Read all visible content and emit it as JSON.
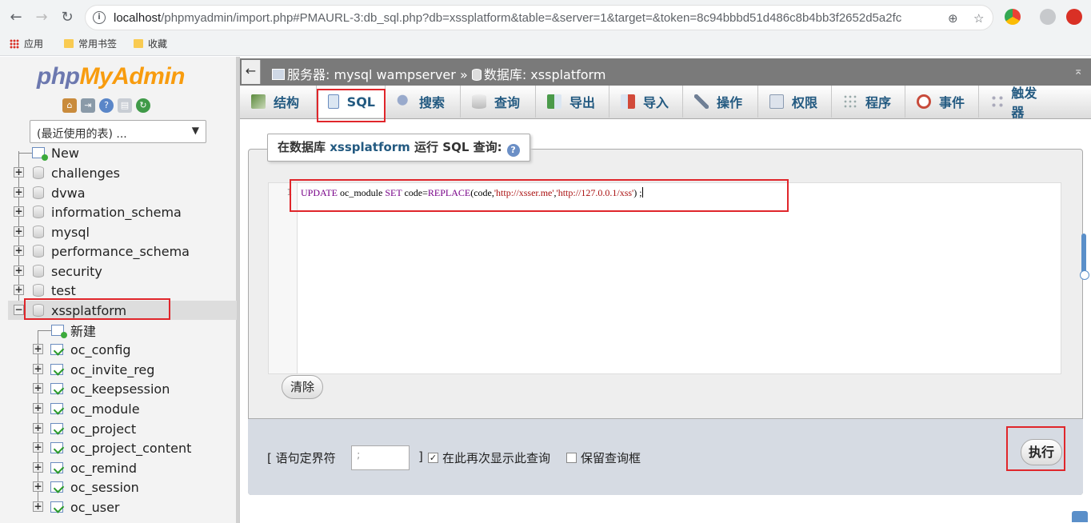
{
  "browser": {
    "url_host": "localhost",
    "url_path": "/phpmyadmin/import.php#PMAURL-3:db_sql.php?db=xssplatform&table=&server=1&target=&token=8c94bbbd51d486c8b4bb3f2652d5a2fc",
    "bookmarks": [
      "应用",
      "常用书签",
      "收藏"
    ]
  },
  "sidebar": {
    "logo": {
      "php": "php",
      "my": "My",
      "admin": "Admin"
    },
    "recent_select": "(最近使用的表) ...",
    "new_label": "New",
    "databases": [
      "challenges",
      "dvwa",
      "information_schema",
      "mysql",
      "performance_schema",
      "security",
      "test",
      "xssplatform"
    ],
    "xss_new_label": "新建",
    "tables": [
      "oc_config",
      "oc_invite_reg",
      "oc_keepsession",
      "oc_module",
      "oc_project",
      "oc_project_content",
      "oc_remind",
      "oc_session",
      "oc_user"
    ]
  },
  "breadcrumb": {
    "server_label": "服务器: mysql wampserver",
    "sep": "»",
    "db_label": "数据库: xssplatform"
  },
  "tabs": [
    {
      "label": "结构",
      "icon": "structure-icon"
    },
    {
      "label": "SQL",
      "icon": "sql-icon"
    },
    {
      "label": "搜索",
      "icon": "search-icon"
    },
    {
      "label": "查询",
      "icon": "query-icon"
    },
    {
      "label": "导出",
      "icon": "export-icon"
    },
    {
      "label": "导入",
      "icon": "import-icon"
    },
    {
      "label": "操作",
      "icon": "wrench-icon"
    },
    {
      "label": "权限",
      "icon": "privileges-icon"
    },
    {
      "label": "程序",
      "icon": "routines-icon"
    },
    {
      "label": "事件",
      "icon": "events-icon"
    },
    {
      "label": "触发器",
      "icon": "triggers-icon"
    }
  ],
  "query": {
    "legend_prefix": "在数据库",
    "legend_db": "xssplatform",
    "legend_suffix": "运行 SQL 查询:",
    "line_number": "1",
    "code": {
      "kw1": "UPDATE",
      "t1": " oc_module ",
      "kw2": "SET",
      "t2": " code=",
      "fn": "REPLACE",
      "t3": "(code,",
      "s1": "'http://xsser.me'",
      "t4": ",",
      "s2": "'http://127.0.0.1/xss'",
      "t5": ") ;"
    },
    "clear_label": "清除"
  },
  "options": {
    "delimiter_label": "[ 语句定界符",
    "delimiter_value": ";",
    "delimiter_close": "]",
    "show_again_label": "在此再次显示此查询",
    "show_again_checked": true,
    "retain_box_label": "保留查询框",
    "retain_box_checked": false,
    "go_label": "执行"
  }
}
